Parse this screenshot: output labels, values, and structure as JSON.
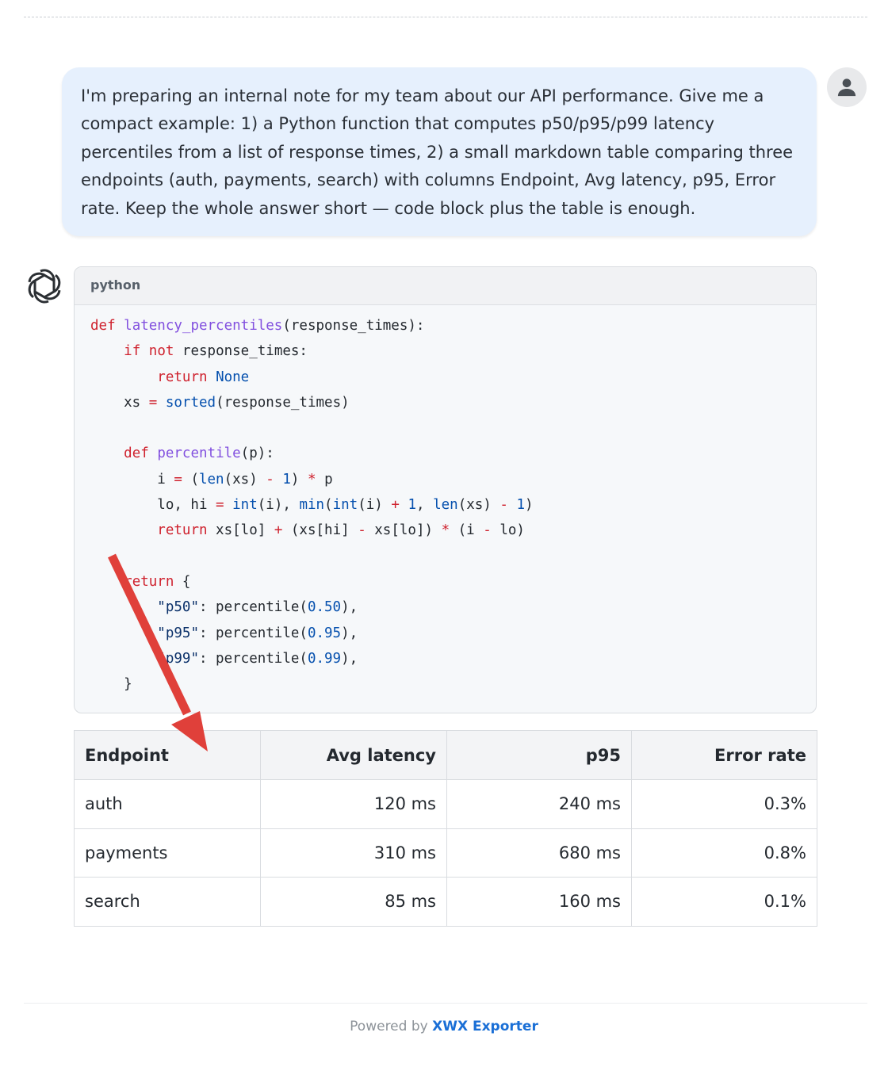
{
  "user_message": {
    "text": "I'm preparing an internal note for my team about our API performance. Give me a compact example: 1) a Python function that computes p50/p95/p99 latency percentiles from a list of response times, 2) a small markdown table comparing three endpoints (auth, payments, search) with columns Endpoint, Avg latency, p95, Error rate. Keep the whole answer short — code block plus the table is enough."
  },
  "icons": {
    "user_avatar": "person-icon",
    "assistant_logo": "openai-logo-icon",
    "annotation": "red-arrow-icon"
  },
  "colors": {
    "user_bubble": "#e6f0fd",
    "code_keyword": "#cf222e",
    "code_function": "#8250df",
    "code_number": "#0550ae",
    "arrow": "#e0403a",
    "footer_link": "#1a6fd6"
  },
  "code_block": {
    "language": "python",
    "lines": [
      [
        {
          "t": "def",
          "c": "kw"
        },
        {
          "t": " "
        },
        {
          "t": "latency_percentiles",
          "c": "fn"
        },
        {
          "t": "(response_times):"
        }
      ],
      [
        {
          "t": "    "
        },
        {
          "t": "if",
          "c": "kw"
        },
        {
          "t": " "
        },
        {
          "t": "not",
          "c": "kw"
        },
        {
          "t": " response_times:"
        }
      ],
      [
        {
          "t": "        "
        },
        {
          "t": "return",
          "c": "kw"
        },
        {
          "t": " "
        },
        {
          "t": "None",
          "c": "bi"
        }
      ],
      [
        {
          "t": "    xs "
        },
        {
          "t": "=",
          "c": "op"
        },
        {
          "t": " "
        },
        {
          "t": "sorted",
          "c": "bi"
        },
        {
          "t": "(response_times)"
        }
      ],
      [
        {
          "t": ""
        }
      ],
      [
        {
          "t": "    "
        },
        {
          "t": "def",
          "c": "kw"
        },
        {
          "t": " "
        },
        {
          "t": "percentile",
          "c": "fn"
        },
        {
          "t": "(p):"
        }
      ],
      [
        {
          "t": "        i "
        },
        {
          "t": "=",
          "c": "op"
        },
        {
          "t": " ("
        },
        {
          "t": "len",
          "c": "bi"
        },
        {
          "t": "(xs) "
        },
        {
          "t": "-",
          "c": "op"
        },
        {
          "t": " "
        },
        {
          "t": "1",
          "c": "num"
        },
        {
          "t": ") "
        },
        {
          "t": "*",
          "c": "op"
        },
        {
          "t": " p"
        }
      ],
      [
        {
          "t": "        lo, hi "
        },
        {
          "t": "=",
          "c": "op"
        },
        {
          "t": " "
        },
        {
          "t": "int",
          "c": "bi"
        },
        {
          "t": "(i), "
        },
        {
          "t": "min",
          "c": "bi"
        },
        {
          "t": "("
        },
        {
          "t": "int",
          "c": "bi"
        },
        {
          "t": "(i) "
        },
        {
          "t": "+",
          "c": "op"
        },
        {
          "t": " "
        },
        {
          "t": "1",
          "c": "num"
        },
        {
          "t": ", "
        },
        {
          "t": "len",
          "c": "bi"
        },
        {
          "t": "(xs) "
        },
        {
          "t": "-",
          "c": "op"
        },
        {
          "t": " "
        },
        {
          "t": "1",
          "c": "num"
        },
        {
          "t": ")"
        }
      ],
      [
        {
          "t": "        "
        },
        {
          "t": "return",
          "c": "kw"
        },
        {
          "t": " xs[lo] "
        },
        {
          "t": "+",
          "c": "op"
        },
        {
          "t": " (xs[hi] "
        },
        {
          "t": "-",
          "c": "op"
        },
        {
          "t": " xs[lo]) "
        },
        {
          "t": "*",
          "c": "op"
        },
        {
          "t": " (i "
        },
        {
          "t": "-",
          "c": "op"
        },
        {
          "t": " lo)"
        }
      ],
      [
        {
          "t": ""
        }
      ],
      [
        {
          "t": "    "
        },
        {
          "t": "return",
          "c": "kw"
        },
        {
          "t": " {"
        }
      ],
      [
        {
          "t": "        "
        },
        {
          "t": "\"p50\"",
          "c": "str"
        },
        {
          "t": ": percentile("
        },
        {
          "t": "0.50",
          "c": "num"
        },
        {
          "t": "),"
        }
      ],
      [
        {
          "t": "        "
        },
        {
          "t": "\"p95\"",
          "c": "str"
        },
        {
          "t": ": percentile("
        },
        {
          "t": "0.95",
          "c": "num"
        },
        {
          "t": "),"
        }
      ],
      [
        {
          "t": "        "
        },
        {
          "t": "\"p99\"",
          "c": "str"
        },
        {
          "t": ": percentile("
        },
        {
          "t": "0.99",
          "c": "num"
        },
        {
          "t": "),"
        }
      ],
      [
        {
          "t": "    }"
        }
      ]
    ]
  },
  "table": {
    "headers": [
      "Endpoint",
      "Avg latency",
      "p95",
      "Error rate"
    ],
    "rows": [
      [
        "auth",
        "120 ms",
        "240 ms",
        "0.3%"
      ],
      [
        "payments",
        "310 ms",
        "680 ms",
        "0.8%"
      ],
      [
        "search",
        "85 ms",
        "160 ms",
        "0.1%"
      ]
    ]
  },
  "footer": {
    "prefix": "Powered by",
    "link": "XWX Exporter"
  }
}
